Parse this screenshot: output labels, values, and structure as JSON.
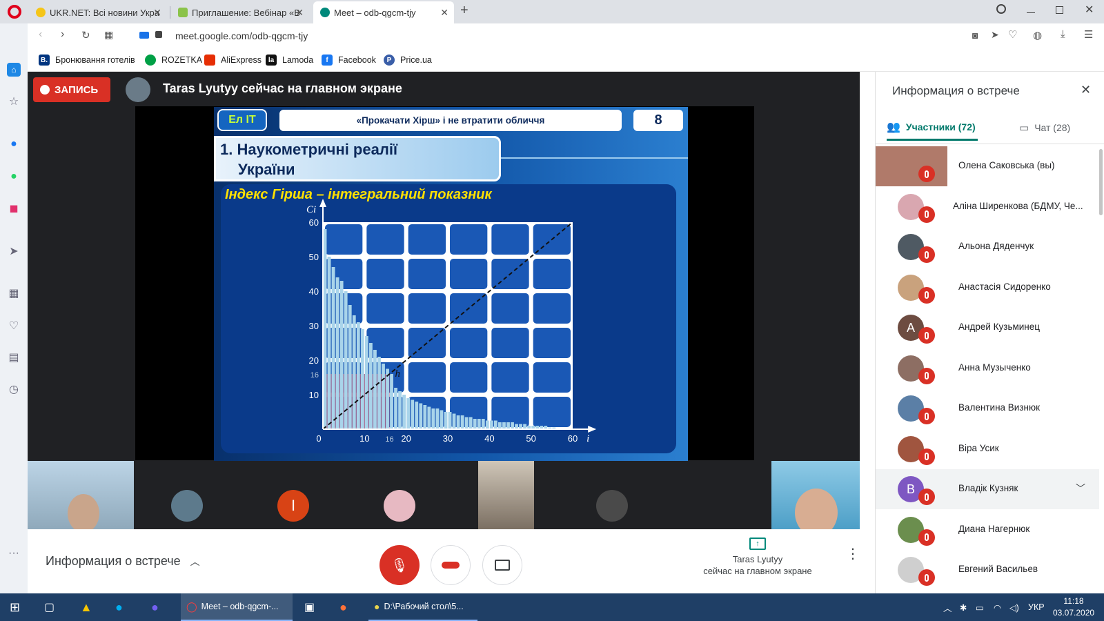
{
  "browser": {
    "tabs": [
      {
        "label": "UKR.NET: Всі новини Укра",
        "active": false
      },
      {
        "label": "Приглашение: Вебінар «В",
        "active": false
      },
      {
        "label": "Meet – odb-qgcm-tjy",
        "active": true
      }
    ],
    "url": "meet.google.com/odb-qgcm-tjy",
    "bookmarks": [
      "Бронювання готелів",
      "ROZETKA",
      "AliExpress",
      "Lamoda",
      "Facebook",
      "Price.ua"
    ]
  },
  "meet": {
    "record_label": "ЗАПИСЬ",
    "presenting_text": "Taras Lyutyy сейчас на главном экране",
    "bottom_info_label": "Информация о встрече",
    "present_tile_line1": "Taras Lyutyy",
    "present_tile_line2": "сейчас на главном экране",
    "tile_letter": "I"
  },
  "slide": {
    "logo": "Ел IT",
    "header_title": "«Прокачати Хірш» і не втратити обличчя",
    "page_number": "8",
    "section_line1": "1. Наукометричні реалії",
    "section_line2": "України",
    "subtitle": "Індекс Гірша – інтегральний показник",
    "y_axis_label": "Ci",
    "x_axis_label": "i",
    "h_label": "h"
  },
  "chart_data": {
    "type": "bar",
    "title": "Індекс Гірша – інтегральний показник",
    "xlabel": "i",
    "ylabel": "Ci",
    "xlim": [
      0,
      60
    ],
    "ylim": [
      0,
      60
    ],
    "x_ticks": [
      "0",
      "10",
      "16",
      "20",
      "30",
      "40",
      "50",
      "60"
    ],
    "y_ticks": [
      "10",
      "16",
      "20",
      "30",
      "40",
      "50",
      "60"
    ],
    "h_index": 16,
    "values": [
      58,
      50,
      47,
      44,
      43,
      40,
      36,
      33,
      31,
      29,
      27,
      25,
      23,
      21,
      19,
      17.5,
      16,
      12,
      11,
      10,
      9,
      8.5,
      8,
      7.5,
      7,
      6.5,
      6,
      6,
      5.5,
      5,
      5,
      4.5,
      4,
      4,
      3.5,
      3.5,
      3,
      3,
      3,
      2.5,
      2.5,
      2.5,
      2,
      2,
      2,
      2,
      1.5,
      1.5,
      1.5,
      1,
      1,
      1,
      1,
      1,
      0.5,
      0.5
    ]
  },
  "panel": {
    "title": "Информация о встрече",
    "tab_participants": "Участники (72)",
    "tab_chat": "Чат (28)",
    "participants": [
      {
        "name": "Олена Саковська (вы)",
        "avatar": "photo",
        "color": "#b07a6a"
      },
      {
        "name": "Аліна Ширенкова (БДМУ, Че...",
        "avatar": "photo",
        "color": "#d9a7b0"
      },
      {
        "name": "Альона Дяденчук",
        "avatar": "photo",
        "color": "#4f5a63"
      },
      {
        "name": "Анастасія Сидоренко",
        "avatar": "photo",
        "color": "#c9a27d"
      },
      {
        "name": "Андрей Кузьминец",
        "avatar": "A",
        "color": "#6d4c41"
      },
      {
        "name": "Анна Музыченко",
        "avatar": "photo",
        "color": "#8d6e63"
      },
      {
        "name": "Валентина Визнюк",
        "avatar": "photo",
        "color": "#5b7fa6"
      },
      {
        "name": "Віра Усик",
        "avatar": "photo",
        "color": "#a0553f"
      },
      {
        "name": "Владік Кузняк",
        "avatar": "B",
        "color": "#7e57c2"
      },
      {
        "name": "Диана Нагернюк",
        "avatar": "photo",
        "color": "#6b8e4e"
      },
      {
        "name": "Евгений Васильев",
        "avatar": "photo",
        "color": "#cfcfcf"
      }
    ]
  },
  "taskbar": {
    "items": [
      "Meet – odb-qgcm-...",
      "D:\\Рабочий стол\\5..."
    ],
    "lang": "УКР",
    "time": "11:18",
    "date": "03.07.2020"
  }
}
